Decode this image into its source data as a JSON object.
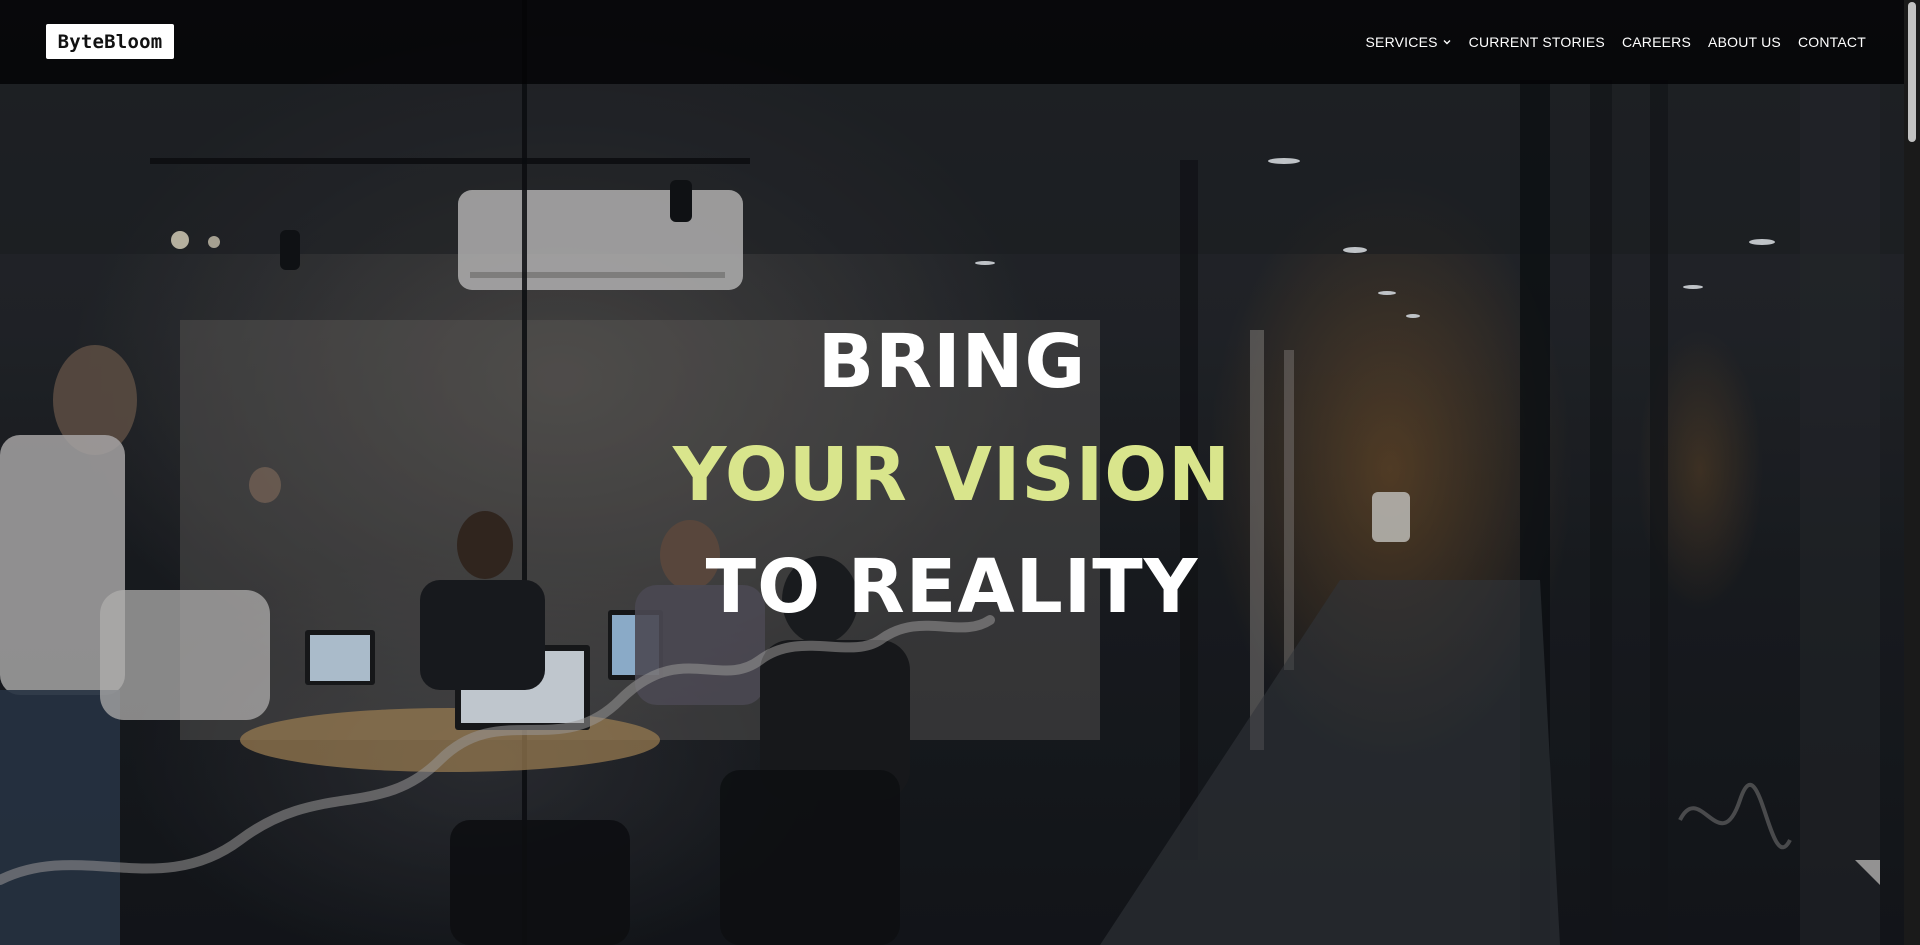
{
  "brand": {
    "logo_text": "ByteBloom"
  },
  "nav": {
    "items": [
      {
        "label": "SERVICES",
        "has_dropdown": true,
        "icon": "chevron-down-icon"
      },
      {
        "label": "CURRENT STORIES"
      },
      {
        "label": "CAREERS"
      },
      {
        "label": "ABOUT US"
      },
      {
        "label": "CONTACT"
      }
    ]
  },
  "hero": {
    "line1": "BRING",
    "line2": "YOUR VISION",
    "line3": "TO REALITY",
    "accent_color": "#d9e58c",
    "background_image": "dark office meeting room behind glass, people working on laptops"
  }
}
